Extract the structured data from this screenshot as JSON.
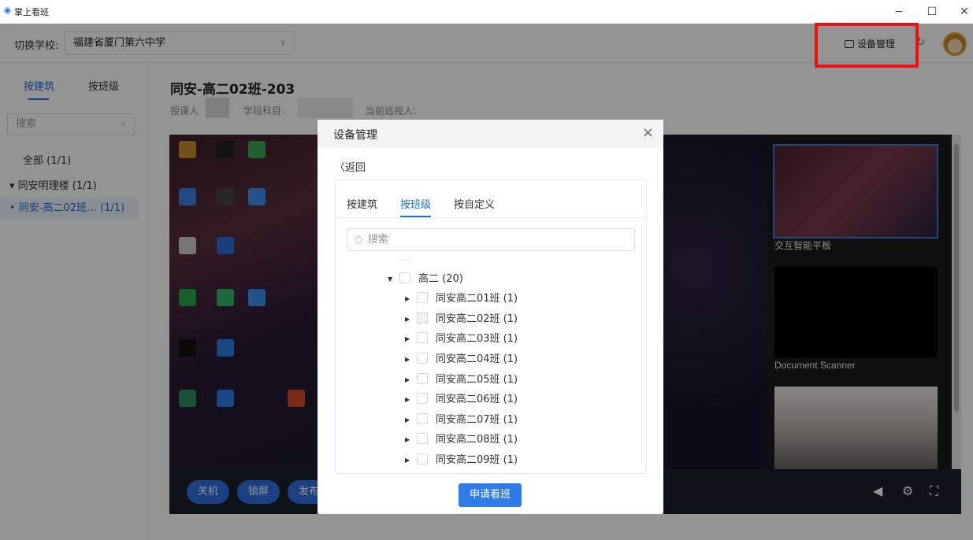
{
  "window": {
    "title": "掌上看班",
    "controls": [
      "−",
      "☐",
      "✕"
    ]
  },
  "toolbar": {
    "school_label": "切换学校:",
    "school_value": "福建省厦门第六中学",
    "device_manage": "设备管理"
  },
  "sidebar": {
    "tabs": [
      "按建筑",
      "按班级"
    ],
    "search_placeholder": "搜索",
    "tree": [
      "全部 (1/1)",
      "▾ 同安明理楼 (1/1)",
      "• 同安-高二02班… (1/1)"
    ]
  },
  "main": {
    "title": "同安-高二02班-203",
    "teacher_label": "授课人",
    "subject_label": "学段科目:",
    "watcher_label": "当前巡视人:",
    "thumb_labels": [
      "交互智能平板",
      "Document Scanner"
    ],
    "controls": [
      "关机",
      "锁屏",
      "发布"
    ]
  },
  "modal": {
    "title": "设备管理",
    "close": "×",
    "back": "〈返回",
    "tabs": [
      "按建筑",
      "按班级",
      "按自定义"
    ],
    "active_tab": "按班级",
    "search_placeholder": "搜索",
    "tree": [
      {
        "label": "高二 (20)",
        "level": 1,
        "expanded": true
      },
      {
        "label": "同安高二01班 (1)",
        "level": 2
      },
      {
        "label": "同安高二02班 (1)",
        "level": 2,
        "disabled": true
      },
      {
        "label": "同安高二03班 (1)",
        "level": 2
      },
      {
        "label": "同安高二04班 (1)",
        "level": 2
      },
      {
        "label": "同安高二05班 (1)",
        "level": 2
      },
      {
        "label": "同安高二06班 (1)",
        "level": 2
      },
      {
        "label": "同安高二07班 (1)",
        "level": 2
      },
      {
        "label": "同安高二08班 (1)",
        "level": 2
      },
      {
        "label": "同安高二09班 (1)",
        "level": 2
      }
    ],
    "apply_button": "申请看班"
  },
  "colors": {
    "accent": "#2f7be8",
    "highlight": "#e11111"
  }
}
